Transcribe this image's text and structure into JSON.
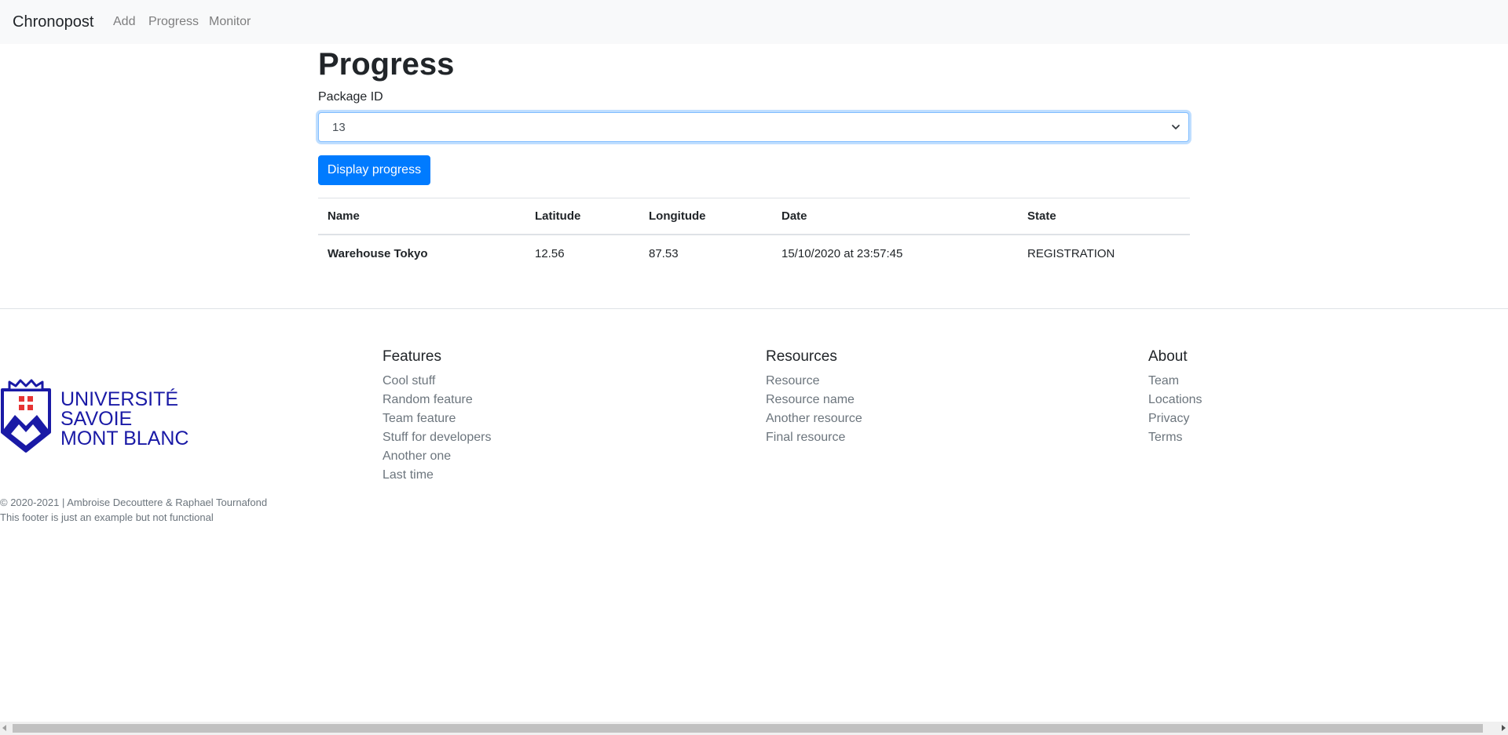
{
  "navbar": {
    "brand": "Chronopost",
    "links": [
      "Add",
      "Progress",
      "Monitor"
    ]
  },
  "main": {
    "title": "Progress",
    "package_label": "Package ID",
    "package_selected": "13",
    "display_button": "Display progress"
  },
  "table": {
    "columns": [
      "Name",
      "Latitude",
      "Longitude",
      "Date",
      "State"
    ],
    "rows": [
      [
        "Warehouse Tokyo",
        "12.56",
        "87.53",
        "15/10/2020 at 23:57:45",
        "REGISTRATION"
      ]
    ]
  },
  "footer": {
    "logo": {
      "line1": "UNIVERSITÉ",
      "line2": "SAVOIE",
      "line3": "MONT BLANC"
    },
    "copyright": "© 2020-2021 | Ambroise Decouttere & Raphael Tournafond",
    "note": "This footer is just an example but not functional",
    "columns": [
      {
        "title": "Features",
        "items": [
          "Cool stuff",
          "Random feature",
          "Team feature",
          "Stuff for developers",
          "Another one",
          "Last time"
        ]
      },
      {
        "title": "Resources",
        "items": [
          "Resource",
          "Resource name",
          "Another resource",
          "Final resource"
        ]
      },
      {
        "title": "About",
        "items": [
          "Team",
          "Locations",
          "Privacy",
          "Terms"
        ]
      }
    ]
  },
  "colors": {
    "primary": "#007bff",
    "logo_blue": "#1a1aa6",
    "logo_red": "#e63333",
    "muted": "#6c757d"
  },
  "icons": {
    "select": "chevron-down-icon",
    "logo": "university-crest-icon"
  }
}
